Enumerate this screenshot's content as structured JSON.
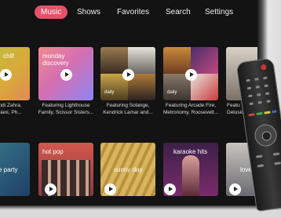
{
  "nav": {
    "tabs": [
      "Music",
      "Shows",
      "Favorites",
      "Search",
      "Settings"
    ],
    "active_tab": "Music"
  },
  "row1": [
    {
      "title": "chill",
      "caption": "Hindi Zahra,\nluciani, Ph..."
    },
    {
      "title": "monday\ndiscovery",
      "caption": "Featuring Lighthouse\nFamily, Scissor Sisters..."
    },
    {
      "title": "daily",
      "caption": "Featuring Solange,\nKendrick Lamar and..."
    },
    {
      "title": "daily",
      "caption": "Featuring Arcade Fire,\nMetronomy, Roosevelt..."
    },
    {
      "title": "",
      "caption": "Featu\nDelusio"
    }
  ],
  "row2": [
    {
      "title": "e party"
    },
    {
      "title": "hot pop"
    },
    {
      "title": "sunny day"
    },
    {
      "title": "karaoke hits"
    },
    {
      "title": "love fo"
    }
  ],
  "colors": {
    "accent": "#e7526b",
    "background": "#131313"
  }
}
